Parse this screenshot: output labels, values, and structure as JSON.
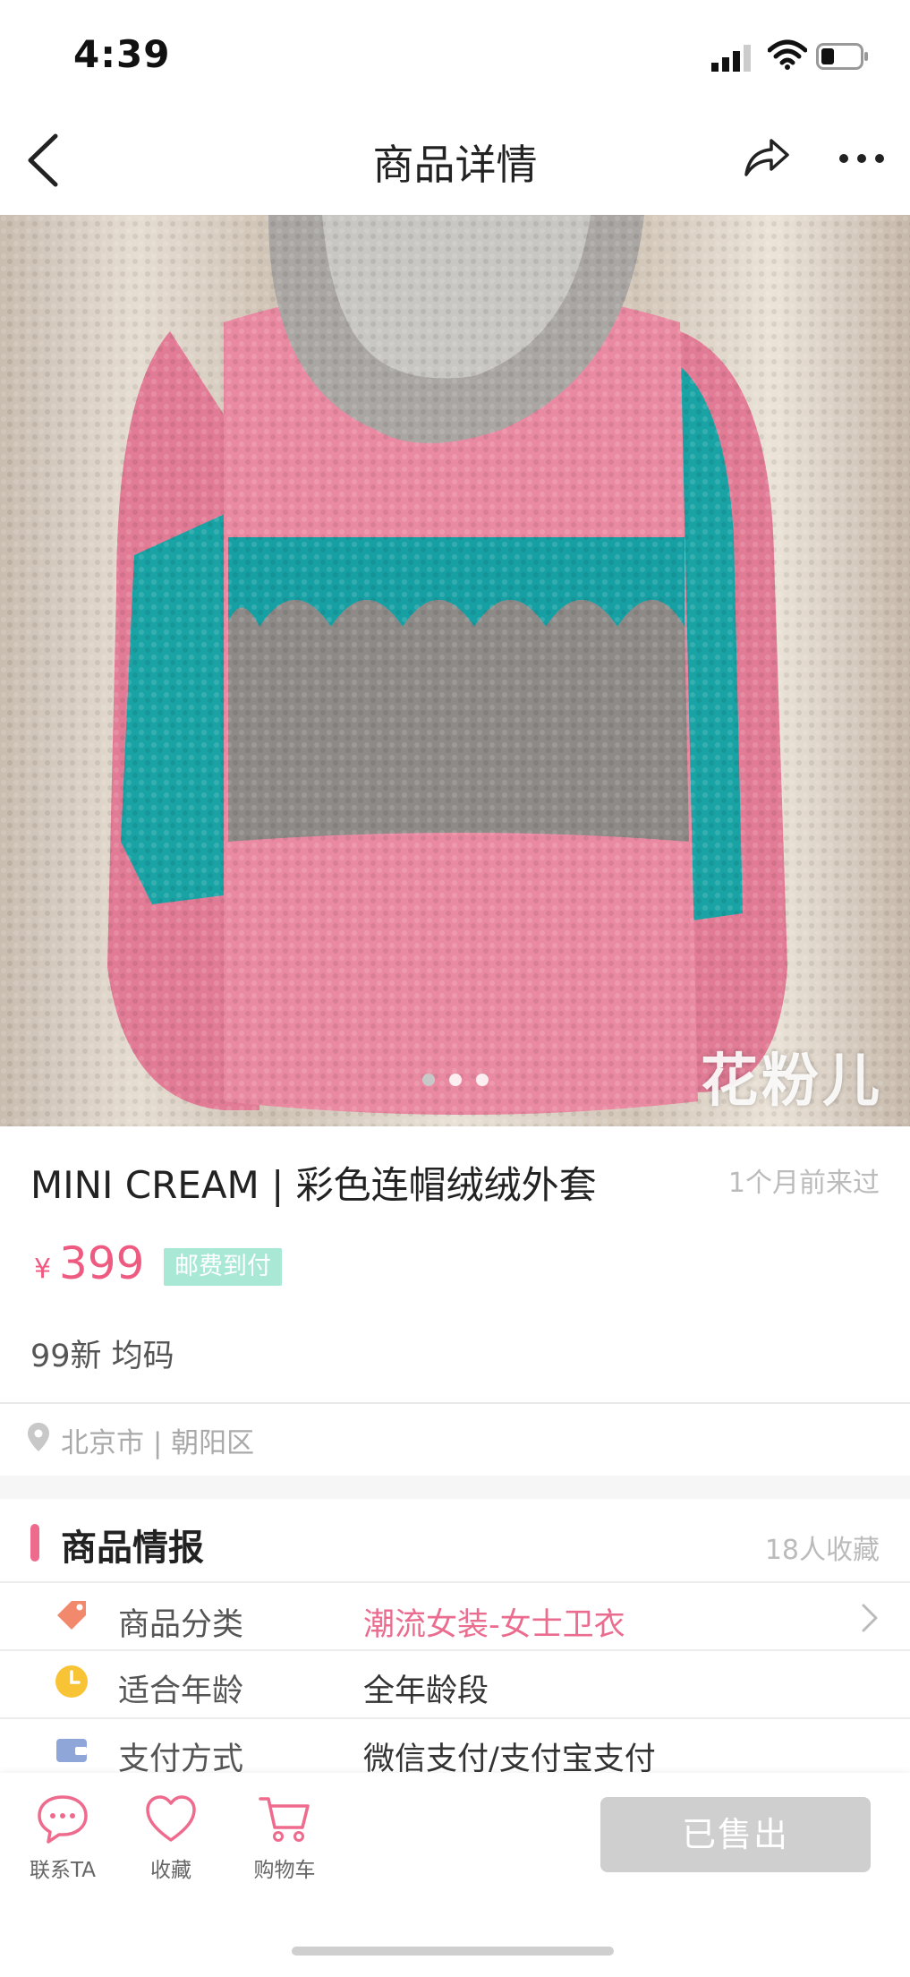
{
  "status_bar": {
    "time": "4:39"
  },
  "nav": {
    "title": "商品详情"
  },
  "photo": {
    "watermark": "花粉儿"
  },
  "product": {
    "title": "MINI CREAM | 彩色连帽绒绒外套",
    "visit_time": "1个月前来过",
    "price_symbol": "¥",
    "price": "399",
    "postage_badge": "邮费到付",
    "condition": "99新 均码"
  },
  "location": {
    "text": "北京市 | 朝阳区"
  },
  "info": {
    "section_title": "商品情报",
    "fav_count": "18人收藏",
    "rows": [
      {
        "label": "商品分类",
        "value": "潮流女装-女士卫衣",
        "icon": "tag-icon"
      },
      {
        "label": "适合年龄",
        "value": "全年龄段",
        "icon": "clock-icon"
      },
      {
        "label": "支付方式",
        "value": "微信支付/支付宝支付",
        "icon": "wallet-icon"
      }
    ]
  },
  "bottom_bar": {
    "contact_label": "联系TA",
    "favorite_label": "收藏",
    "cart_label": "购物车",
    "sold_label": "已售出"
  },
  "colors": {
    "accent_pink": "#ef5a80",
    "postage_badge": "#a9e8d4",
    "sold_button": "#cfcfcf"
  }
}
